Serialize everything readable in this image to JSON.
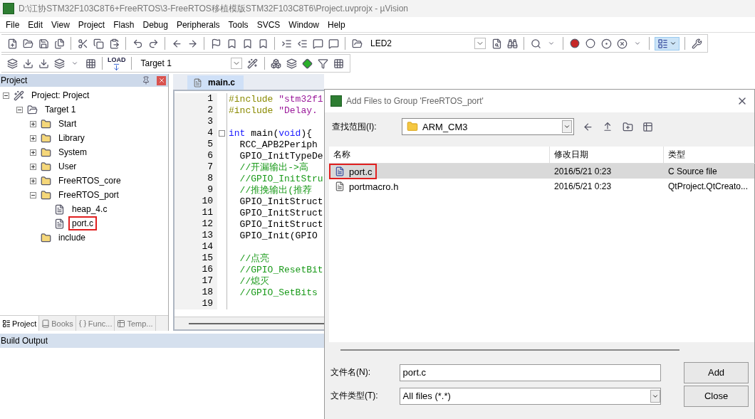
{
  "window": {
    "title": "D:\\江协STM32F103C8T6+FreeRTOS\\3-FreeRTOS移植模版STM32F103C8T6\\Project.uvprojx - µVision"
  },
  "menu": [
    "File",
    "Edit",
    "View",
    "Project",
    "Flash",
    "Debug",
    "Peripherals",
    "Tools",
    "SVCS",
    "Window",
    "Help"
  ],
  "toolbar": {
    "find_field": "LED2",
    "load_label": "LOAD",
    "target": "Target 1"
  },
  "project_panel": {
    "title": "Project",
    "tree": [
      {
        "label": "Project: Project",
        "kind": "root",
        "expanded": true,
        "children": [
          {
            "label": "Target 1",
            "kind": "target",
            "expanded": true,
            "children": [
              {
                "label": "Start",
                "kind": "folder",
                "expanded": false
              },
              {
                "label": "Library",
                "kind": "folder",
                "expanded": false
              },
              {
                "label": "System",
                "kind": "folder",
                "expanded": false
              },
              {
                "label": "User",
                "kind": "folder",
                "expanded": false
              },
              {
                "label": "FreeRTOS_core",
                "kind": "folder",
                "expanded": false
              },
              {
                "label": "FreeRTOS_port",
                "kind": "folder",
                "expanded": true,
                "children": [
                  {
                    "label": "heap_4.c",
                    "kind": "file",
                    "highlighted": false
                  },
                  {
                    "label": "port.c",
                    "kind": "file",
                    "highlighted": true
                  }
                ]
              },
              {
                "label": "include",
                "kind": "folder"
              }
            ]
          }
        ]
      }
    ],
    "tabs": [
      {
        "label": "Project",
        "selected": true
      },
      {
        "label": "Books",
        "selected": false
      },
      {
        "label": "Func...",
        "selected": false
      },
      {
        "label": "Temp...",
        "selected": false
      }
    ]
  },
  "editor": {
    "tab": "main.c",
    "lines": [
      {
        "number": "1",
        "tokens": [
          {
            "text": "#include ",
            "kind": "preprocessor"
          },
          {
            "text": "\"stm32f1",
            "kind": "string"
          }
        ]
      },
      {
        "number": "2",
        "tokens": [
          {
            "text": "#include ",
            "kind": "preprocessor"
          },
          {
            "text": "\"Delay.",
            "kind": "string"
          }
        ]
      },
      {
        "number": "3"
      },
      {
        "number": "4",
        "fold": true,
        "tokens": [
          {
            "text": "int",
            "kind": "keyword"
          },
          {
            "text": " main(",
            "kind": "plain"
          },
          {
            "text": "void",
            "kind": "keyword"
          },
          {
            "text": "){",
            "kind": "plain"
          }
        ]
      },
      {
        "number": "5",
        "tokens": [
          {
            "text": "  RCC_APB2Periph",
            "kind": "plain"
          }
        ]
      },
      {
        "number": "6",
        "tokens": [
          {
            "text": "  GPIO_InitTypeDe",
            "kind": "plain"
          }
        ]
      },
      {
        "number": "7",
        "tokens": [
          {
            "text": "  //开漏输出->高",
            "kind": "comment"
          }
        ]
      },
      {
        "number": "8",
        "tokens": [
          {
            "text": "  //GPIO_InitStru",
            "kind": "comment"
          }
        ]
      },
      {
        "number": "9",
        "tokens": [
          {
            "text": "  //推挽输出(推荐",
            "kind": "comment"
          }
        ]
      },
      {
        "number": "10",
        "tokens": [
          {
            "text": "  GPIO_InitStruct",
            "kind": "plain"
          }
        ]
      },
      {
        "number": "11",
        "tokens": [
          {
            "text": "  GPIO_InitStruct",
            "kind": "plain"
          }
        ]
      },
      {
        "number": "12",
        "tokens": [
          {
            "text": "  GPIO_InitStruct",
            "kind": "plain"
          }
        ]
      },
      {
        "number": "13",
        "tokens": [
          {
            "text": "  GPIO_Init(GPIO",
            "kind": "plain"
          }
        ]
      },
      {
        "number": "14"
      },
      {
        "number": "15",
        "tokens": [
          {
            "text": "  //点亮",
            "kind": "comment"
          }
        ]
      },
      {
        "number": "16",
        "tokens": [
          {
            "text": "  //GPIO_ResetBit",
            "kind": "comment"
          }
        ]
      },
      {
        "number": "17",
        "tokens": [
          {
            "text": "  //熄灭",
            "kind": "comment"
          }
        ]
      },
      {
        "number": "18",
        "tokens": [
          {
            "text": "  //GPIO_SetBits",
            "kind": "comment"
          }
        ]
      },
      {
        "number": "19"
      }
    ]
  },
  "build_output": {
    "title": "Build Output"
  },
  "dialog": {
    "title": "Add Files to Group 'FreeRTOS_port'",
    "look_in_label": "查找范围(I):",
    "look_in": "ARM_CM3",
    "columns": [
      "名称",
      "修改日期",
      "类型"
    ],
    "rows": [
      {
        "name": "port.c",
        "date": "2016/5/21 0:23",
        "type": "C Source file",
        "kind": "c-source",
        "selected": true,
        "highlighted": true
      },
      {
        "name": "portmacro.h",
        "date": "2016/5/21 0:23",
        "type": "QtProject.QtCreato...",
        "kind": "file",
        "selected": false,
        "highlighted": false
      }
    ],
    "filename_label": "文件名(N):",
    "filename": "port.c",
    "filetype_label": "文件类型(T):",
    "filetype": "All files (*.*)",
    "buttons": [
      "Add",
      "Close"
    ]
  }
}
